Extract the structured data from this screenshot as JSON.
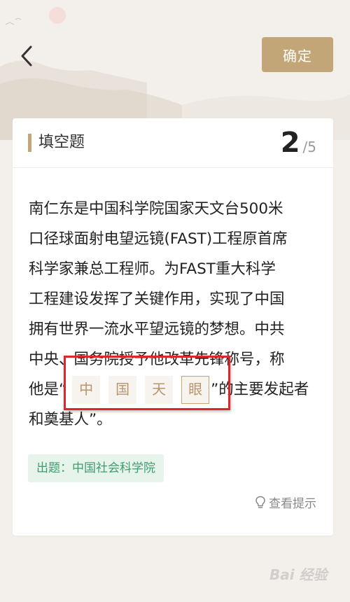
{
  "header": {
    "back_icon": "chevron-left-icon",
    "confirm_label": "确定"
  },
  "card": {
    "question_type": "填空题",
    "progress_current": "2",
    "progress_total": "/5",
    "lines": [
      "南仁东是中国科学院国家天文台500米",
      "口径球面射电望远镜(FAST)工程原首席",
      "科学家兼总工程师。为FAST重大科学",
      "工程建设发挥了关键作用，实现了中国",
      "拥有世界一流水平望远镜的梦想。中共",
      "中央、国务院授予他改革先锋称号，称"
    ],
    "blank_line_prefix": "他是“",
    "blanks": [
      "中",
      "国",
      "天",
      "眼"
    ],
    "blank_line_suffix": "”的主要发起者",
    "last_line": "和奠基人”。",
    "source_label": "出题：中国社会科学院",
    "hint_label": "查看提示",
    "hint_icon": "lightbulb-icon"
  },
  "watermark": "Bai 经验",
  "colors": {
    "accent": "#c2a677",
    "blank_text": "#b8956b",
    "source_bg": "#e6f4ec",
    "source_text": "#3d9e6b",
    "highlight": "#e1262b"
  }
}
